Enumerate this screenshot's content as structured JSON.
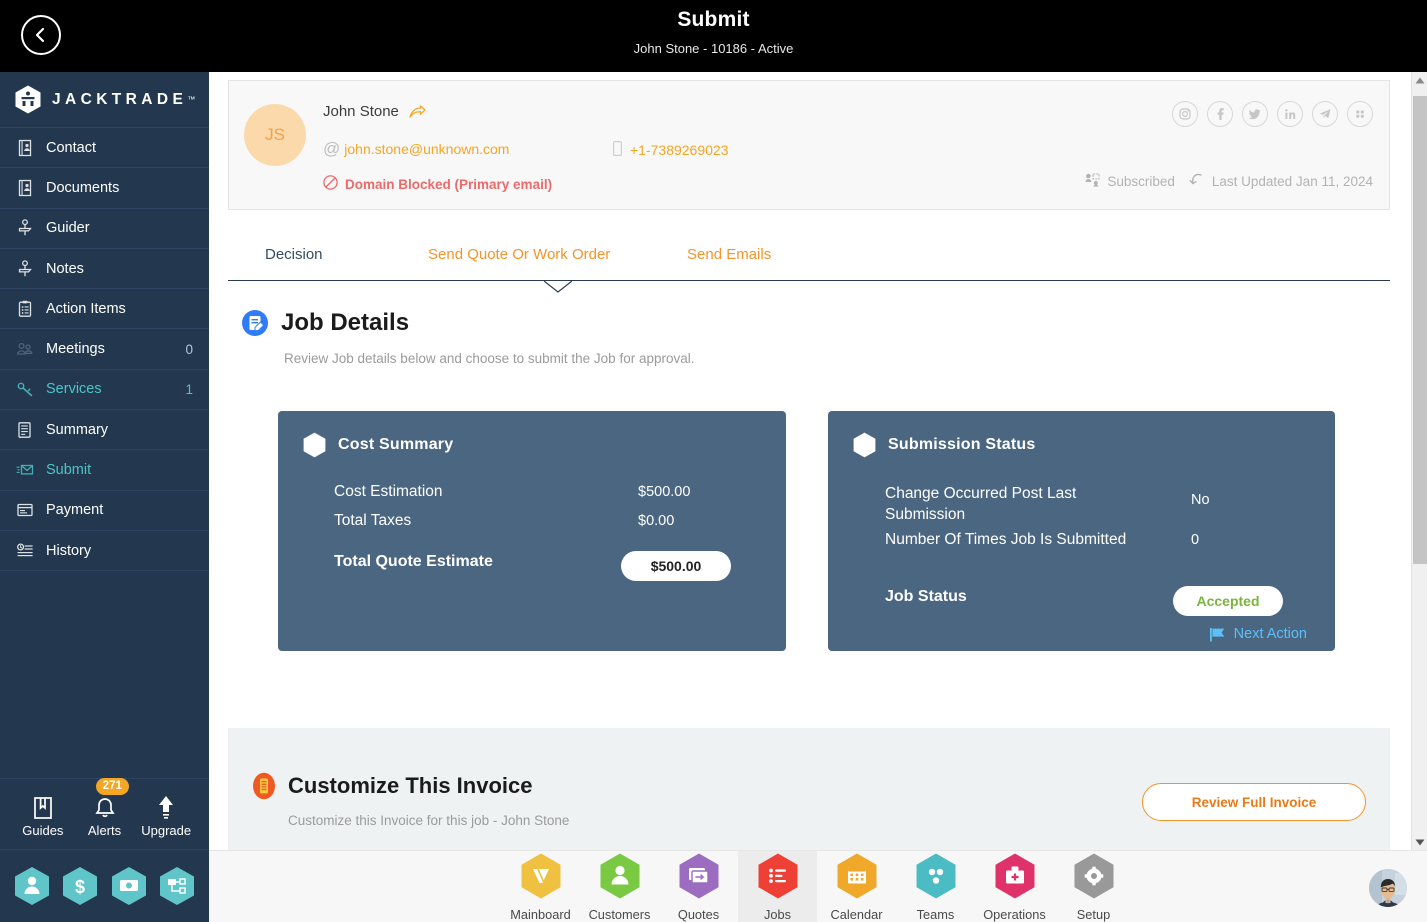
{
  "topbar": {
    "back_icon": "chevron-left-icon",
    "title": "Submit",
    "subtitle": "John Stone - 10186 - Active"
  },
  "sidebar": {
    "brand": "JACKTRADE",
    "brand_tm": "™",
    "items": [
      {
        "label": "Contact",
        "icon": "contact-card-icon",
        "count": ""
      },
      {
        "label": "Documents",
        "icon": "documents-icon",
        "count": ""
      },
      {
        "label": "Guider",
        "icon": "signpost-icon",
        "count": ""
      },
      {
        "label": "Notes",
        "icon": "signpost-icon",
        "count": ""
      },
      {
        "label": "Action Items",
        "icon": "clipboard-icon",
        "count": ""
      },
      {
        "label": "Meetings",
        "icon": "meetings-icon",
        "count": "0"
      },
      {
        "label": "Services",
        "icon": "services-icon",
        "count": "1"
      },
      {
        "label": "Summary",
        "icon": "summary-icon",
        "count": ""
      },
      {
        "label": "Submit",
        "icon": "submit-envelope-icon",
        "count": ""
      },
      {
        "label": "Payment",
        "icon": "payment-icon",
        "count": ""
      },
      {
        "label": "History",
        "icon": "history-icon",
        "count": ""
      }
    ],
    "bottom_tools": [
      {
        "label": "Guides",
        "icon": "book-icon",
        "badge": ""
      },
      {
        "label": "Alerts",
        "icon": "bell-icon",
        "badge": "271"
      },
      {
        "label": "Upgrade",
        "icon": "up-arrow-icon",
        "badge": ""
      }
    ],
    "hex_shortcuts": [
      {
        "icon": "person-hex-icon"
      },
      {
        "icon": "dollar-hex-icon"
      },
      {
        "icon": "money-hex-icon"
      },
      {
        "icon": "workflow-hex-icon"
      }
    ]
  },
  "contact": {
    "initials": "JS",
    "name": "John Stone",
    "share_icon": "share-arrow-icon",
    "email": "john.stone@unknown.com",
    "email_icon": "at-icon",
    "phone": "+1-7389269023",
    "phone_icon": "mobile-icon",
    "blocked_text": "Domain Blocked (Primary email)",
    "blocked_icon": "blocked-icon",
    "social": [
      {
        "name": "instagram-icon",
        "glyph": "▣"
      },
      {
        "name": "facebook-icon",
        "glyph": "f"
      },
      {
        "name": "twitter-icon",
        "glyph": "ᴠ"
      },
      {
        "name": "linkedin-icon",
        "glyph": "in"
      },
      {
        "name": "telegram-icon",
        "glyph": "➤"
      },
      {
        "name": "apps-grid-icon",
        "glyph": "∷"
      }
    ],
    "subscribed_label": "Subscribed",
    "subscribed_icon": "subscriber-icon",
    "last_updated_label": "Last Updated Jan 11, 2024",
    "last_updated_icon": "refresh-icon"
  },
  "tabs": [
    {
      "label": "Decision",
      "active": true
    },
    {
      "label": "Send Quote Or Work Order",
      "active": false
    },
    {
      "label": "Send Emails",
      "active": false
    }
  ],
  "job_details": {
    "icon": "job-details-icon",
    "title": "Job Details",
    "subtitle": "Review Job details below and choose to submit the Job for approval."
  },
  "cost_summary": {
    "icon": "hexagon-icon",
    "title": "Cost Summary",
    "rows": [
      {
        "label": "Cost Estimation",
        "value": "$500.00"
      },
      {
        "label": "Total Taxes",
        "value": "$0.00"
      }
    ],
    "total_label": "Total Quote Estimate",
    "total_value": "$500.00"
  },
  "submission_status": {
    "icon": "hexagon-icon",
    "title": "Submission Status",
    "rows": [
      {
        "label": "Change Occurred Post Last Submission",
        "value": "No"
      },
      {
        "label": "Number Of Times Job Is Submitted",
        "value": "0"
      }
    ],
    "job_status_label": "Job Status",
    "job_status_value": "Accepted",
    "next_action_label": "Next Action",
    "next_action_icon": "flag-icon"
  },
  "invoice": {
    "icon": "invoice-icon",
    "title": "Customize This Invoice",
    "subtitle": "Customize this Invoice for this job - John Stone",
    "button_label": "Review Full Invoice"
  },
  "bottom_nav": [
    {
      "label": "Mainboard",
      "icon": "mainboard-hex-icon",
      "color": "#f0c040",
      "selected": false
    },
    {
      "label": "Customers",
      "icon": "customers-hex-icon",
      "color": "#7ac943",
      "selected": false
    },
    {
      "label": "Quotes",
      "icon": "quotes-hex-icon",
      "color": "#9b6cc0",
      "selected": false
    },
    {
      "label": "Jobs",
      "icon": "jobs-hex-icon",
      "color": "#ef4036",
      "selected": true
    },
    {
      "label": "Calendar",
      "icon": "calendar-hex-icon",
      "color": "#f0a82a",
      "selected": false
    },
    {
      "label": "Teams",
      "icon": "teams-hex-icon",
      "color": "#4cbcc4",
      "selected": false
    },
    {
      "label": "Operations",
      "icon": "operations-hex-icon",
      "color": "#e0326a",
      "selected": false
    },
    {
      "label": "Setup",
      "icon": "setup-hex-icon",
      "color": "#999999",
      "selected": false
    }
  ],
  "user_avatar": {
    "icon": "user-photo-avatar"
  },
  "colors": {
    "sidebar": "#23384f",
    "card": "#4b6681",
    "accent_orange": "#f5942a",
    "teal": "#4ec3c7",
    "green": "#7bb53f",
    "blue_link": "#5bc0f8",
    "red": "#ec6a6a"
  },
  "scrollbar": {
    "up_icon": "scroll-up-arrow-icon",
    "down_icon": "scroll-down-arrow-icon"
  }
}
